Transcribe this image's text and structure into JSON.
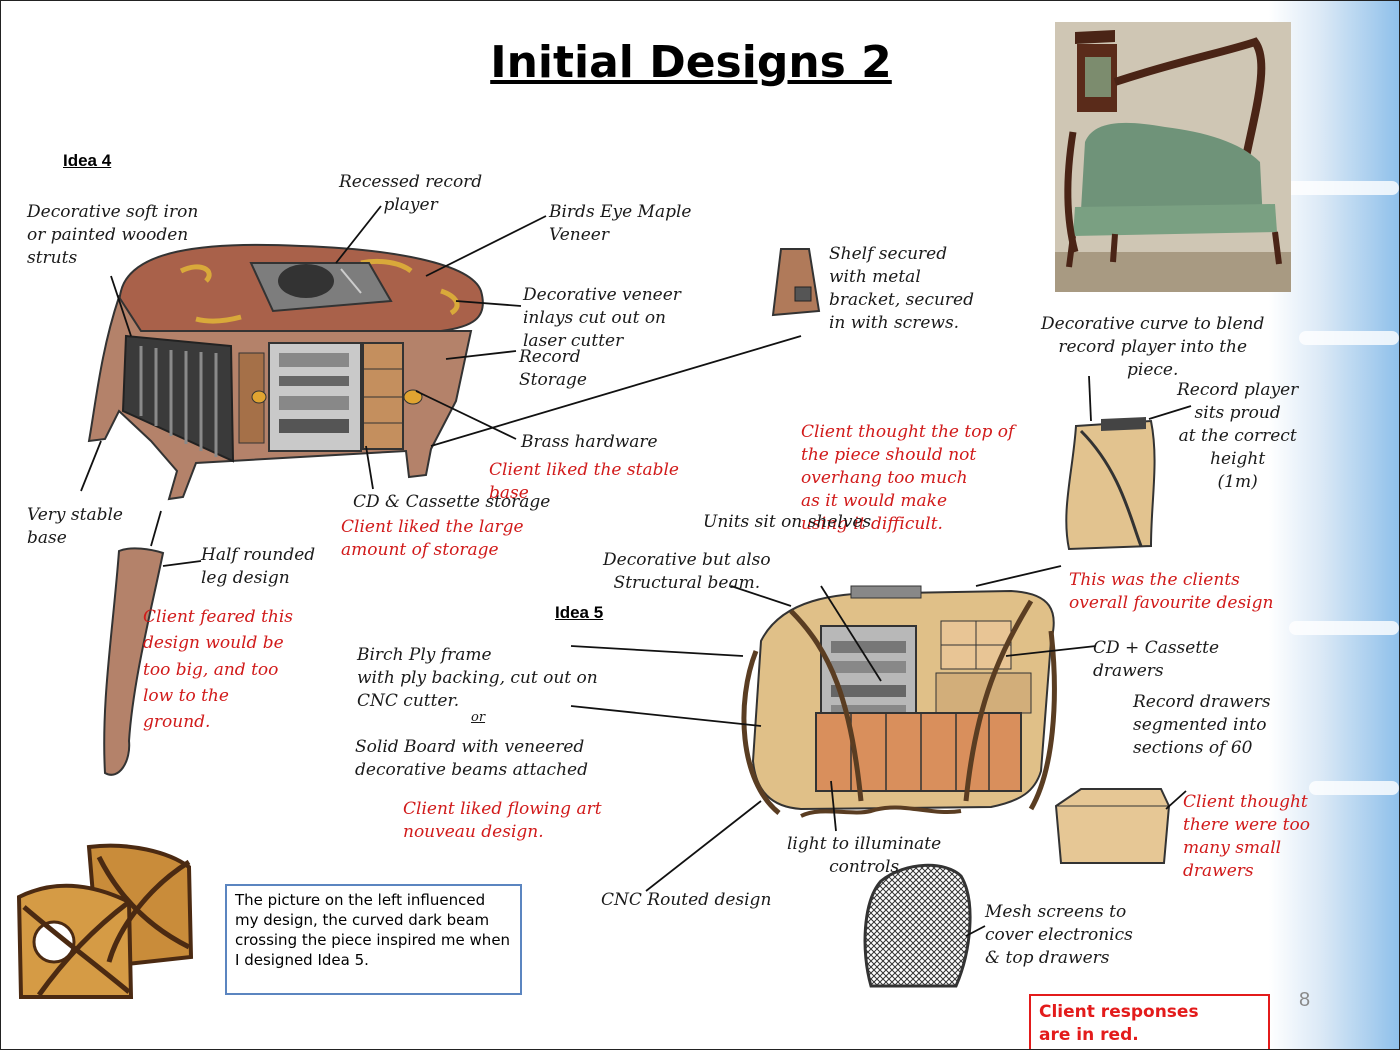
{
  "title": "Initial Designs 2",
  "idea4": {
    "label": "Idea 4",
    "notes": {
      "struts": "Decorative soft iron\nor painted wooden\nstruts",
      "record_player": "Recessed record\nplayer",
      "veneer": "Birds Eye Maple\nVeneer",
      "inlays": "Decorative veneer\ninlays cut out on\nlaser cutter",
      "record_storage": "Record\nStorage",
      "brass": "Brass hardware",
      "cd_storage": "CD & Cassette storage",
      "stable_base": "Very stable\nbase",
      "half_rounded": "Half rounded\nleg design"
    },
    "client": {
      "stable_base": "Client liked the stable\nbase",
      "storage": "Client liked the large\namount of storage",
      "too_big": "Client feared this\ndesign would be\ntoo big, and too\nlow to the\nground."
    }
  },
  "shelf": {
    "note": "Shelf secured\nwith metal\nbracket, secured\nin with screws."
  },
  "idea5": {
    "label": "Idea 5",
    "notes": {
      "curve": "Decorative curve to blend\nrecord player into the\npiece.",
      "sits_proud": "Record player\nsits proud\nat the correct\nheight\n(1m)",
      "units": "Units sit on shelves",
      "beam": "Decorative but also\nStructural beam.",
      "frame": "Birch Ply frame\nwith ply backing, cut out on\nCNC cutter.",
      "or": "or",
      "solid": "Solid Board with veneered\ndecorative beams attached",
      "cd_drawers": "CD + Cassette\ndrawers",
      "record_drawers": "Record drawers\nsegmented into\nsections of 60",
      "light": "light to illuminate\ncontrols",
      "cnc_routed": "CNC Routed design",
      "mesh": "Mesh screens to\ncover electronics\n& top drawers"
    },
    "client": {
      "top_overhang": "Client thought the top of\nthe piece should not\noverhang too much\nas it would make\nusing it difficult.",
      "favourite": "This was the clients\noverall favourite design",
      "art_nouveau": "Client liked flowing art\nnouveau design.",
      "too_many": "Client thought\nthere were too\nmany small\ndrawers"
    }
  },
  "caption": "The picture on the left influenced my design, the curved dark beam crossing the piece inspired me when I designed Idea 5.",
  "legend": "Client responses\nare in red.",
  "page_number": "8",
  "icons": [
    "record-cabinet-sketch",
    "turntable-icon",
    "art-nouveau-bench-photo",
    "art-nouveau-bed-photo",
    "mesh-screen-sketch"
  ],
  "colors": {
    "client_red": "#d11a1a",
    "caption_border": "#5b85c0",
    "legend_red": "#e31b1b"
  }
}
